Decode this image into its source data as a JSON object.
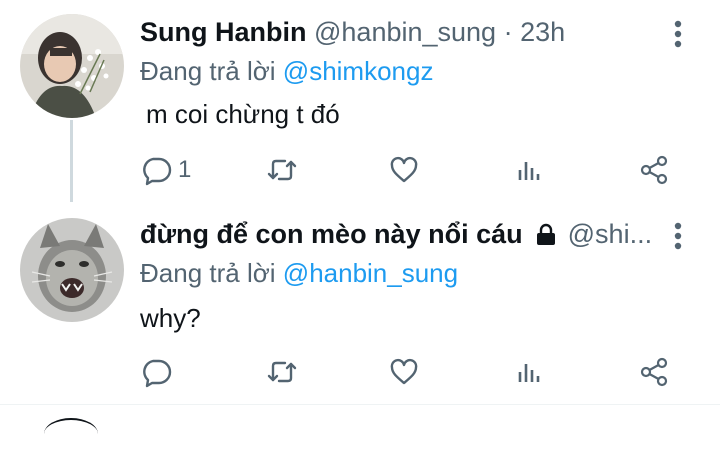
{
  "tweets": [
    {
      "display_name": "Sung Hanbin",
      "handle": "@hanbin_sung",
      "separator": "·",
      "time": "23h",
      "reply_prefix": "Đang trả lời",
      "reply_to": "@shimkongz",
      "text": "m coi chừng t đó",
      "reply_count": "1",
      "avatar_icon": "person-with-flowers-avatar"
    },
    {
      "display_name": "đừng để con mèo này nổi cáu",
      "protected_icon": "lock-icon",
      "handle": "@shi...",
      "reply_prefix": "Đang trả lời",
      "reply_to": "@hanbin_sung",
      "text": "why?",
      "avatar_icon": "screaming-cat-avatar"
    }
  ],
  "colors": {
    "text": "#0f1419",
    "secondary": "#536471",
    "link": "#1d9bf0",
    "thread_line": "#cfd9de"
  }
}
